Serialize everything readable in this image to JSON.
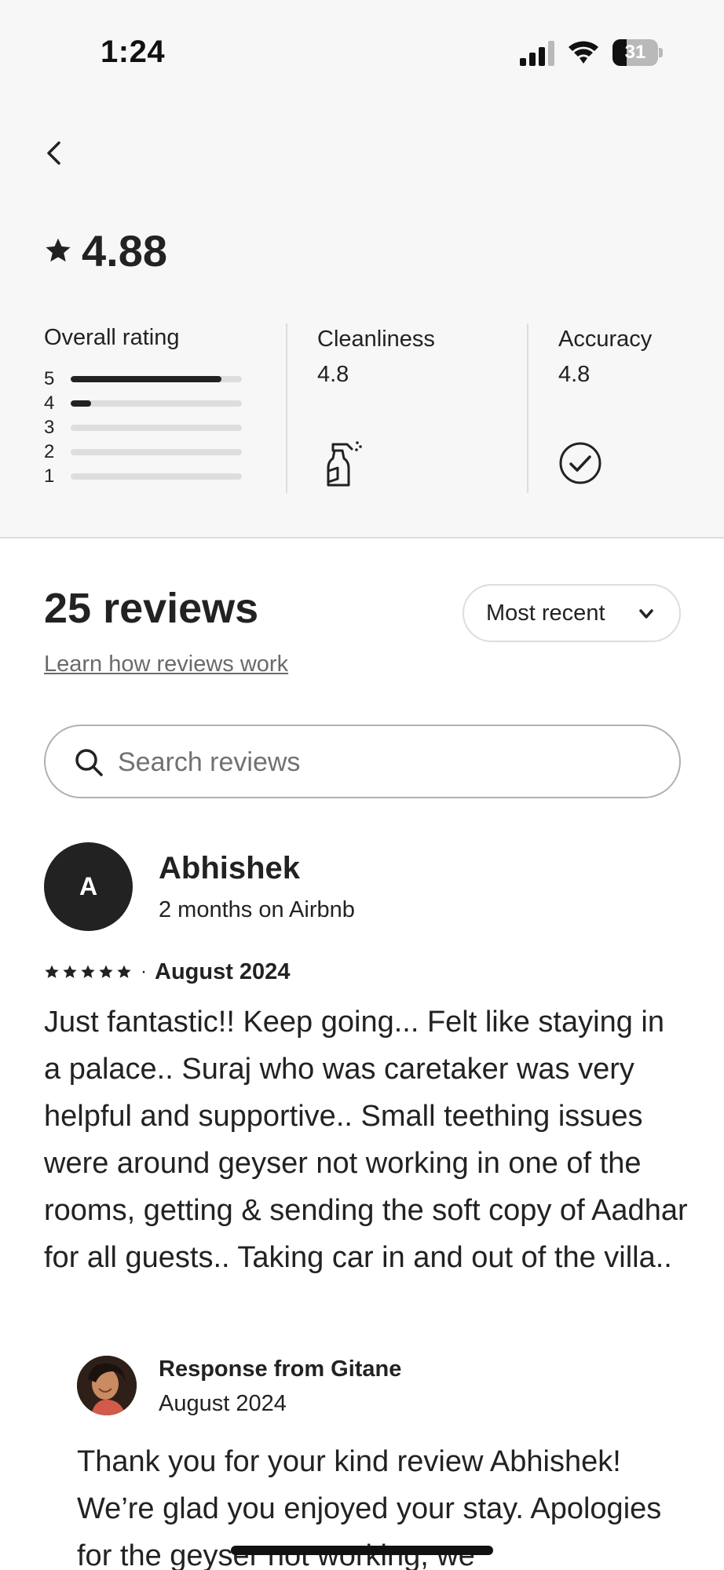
{
  "status_bar": {
    "time": "1:24",
    "battery_level": "31",
    "battery_fraction": 0.31
  },
  "header": {
    "back_icon": "chevron-left-icon"
  },
  "rating": {
    "star_icon": "star-icon",
    "value": "4.88"
  },
  "overall": {
    "title": "Overall rating",
    "bars": [
      {
        "label": "5",
        "fraction": 0.88
      },
      {
        "label": "4",
        "fraction": 0.12
      },
      {
        "label": "3",
        "fraction": 0
      },
      {
        "label": "2",
        "fraction": 0
      },
      {
        "label": "1",
        "fraction": 0
      }
    ]
  },
  "categories": [
    {
      "title": "Cleanliness",
      "value": "4.8",
      "icon": "spray-bottle-icon"
    },
    {
      "title": "Accuracy",
      "value": "4.8",
      "icon": "check-circle-icon"
    }
  ],
  "reviews_section": {
    "count_label": "25 reviews",
    "learn_link": "Learn how reviews work",
    "sort_label": "Most recent",
    "search_placeholder": "Search reviews"
  },
  "review": {
    "avatar_initial": "A",
    "name": "Abhishek",
    "tenure": "2 months on Airbnb",
    "stars": 5,
    "separator": "·",
    "date": "August 2024",
    "text": "Just fantastic!! Keep going... Felt like staying in a palace.. Suraj who was caretaker was very helpful and supportive.. Small teething issues were around geyser not working in one of the rooms, getting & sending the soft copy of Aadhar for all guests.. Taking car in and out of the villa..",
    "response": {
      "title": "Response from Gitane",
      "date": "August 2024",
      "text": "Thank you for your kind review Abhishek! We’re glad you enjoyed your stay. Apologies for the geyser not working, we"
    }
  },
  "colors": {
    "background_top": "#f7f7f7",
    "text": "#222222",
    "muted": "#6a6a6a",
    "border": "#dddddd"
  }
}
